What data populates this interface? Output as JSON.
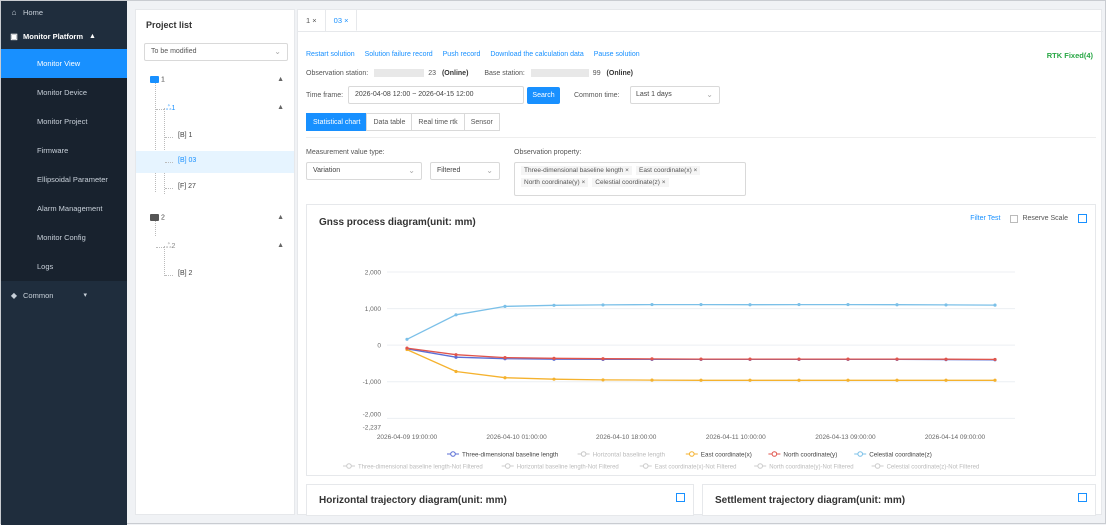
{
  "sidebar": {
    "home": "Home",
    "platform": "Monitor Platform",
    "items": [
      "Monitor View",
      "Monitor Device",
      "Monitor Project",
      "Firmware",
      "Ellipsoidal Parameter",
      "Alarm Management",
      "Monitor Config",
      "Logs"
    ],
    "common": "Common"
  },
  "project": {
    "title": "Project list",
    "select_value": "To be modified",
    "nodes": [
      "1",
      "1",
      "[B] 1",
      "[B] 03",
      "[F] 27",
      "2",
      "2",
      "[B] 2"
    ]
  },
  "tabs": [
    {
      "label": "1"
    },
    {
      "label": "03"
    }
  ],
  "actions": [
    "Restart solution",
    "Solution failure record",
    "Push record",
    "Download the calculation data",
    "Pause solution"
  ],
  "rtk_status": "RTK Fixed(4)",
  "stations": {
    "obs_label": "Observation station:",
    "obs_suffix": "23",
    "obs_status": "(Online)",
    "base_label": "Base station:",
    "base_suffix": "99",
    "base_status": "(Online)"
  },
  "timeframe": {
    "label": "Time frame:",
    "value": "2026-04-08 12:00  ~  2026-04-15 12:00",
    "search": "Search",
    "common_label": "Common time:",
    "common_value": "Last 1 days"
  },
  "subtabs": [
    "Statistical chart",
    "Data table",
    "Real time rtk",
    "Sensor"
  ],
  "filters": {
    "mvt_label": "Measurement value type:",
    "mvt_value": "Variation",
    "filter_value": "Filtered",
    "op_label": "Observation property:",
    "op_tags": [
      "Three-dimensional baseline length",
      "East coordinate(x)",
      "North coordinate(y)",
      "Celestial coordinate(z)"
    ]
  },
  "chart_tools": {
    "filter_test": "Filter Test",
    "reserve_scale": "Reserve Scale"
  },
  "cards": {
    "horizontal": "Horizontal trajectory diagram(unit: mm)",
    "settlement": "Settlement trajectory diagram(unit: mm)"
  },
  "chart_data": {
    "type": "line",
    "title": "Gnss process diagram(unit: mm)",
    "ylim": [
      -2237,
      2000
    ],
    "yticks": [
      "2,000",
      "1,000",
      "0",
      "-1,000",
      "-2,000",
      "-2,237"
    ],
    "ytick_values": [
      2000,
      1000,
      0,
      -1000,
      -2000,
      -2237
    ],
    "xticks": [
      "2026-04-09 19:00:00",
      "2026-04-10 01:00:00",
      "2026-04-10 18:00:00",
      "2026-04-11 10:00:00",
      "2026-04-13 09:00:00",
      "2026-04-14 09:00:00"
    ],
    "grid": true,
    "legend_position": "bottom",
    "series": [
      {
        "name": "Three-dimensional baseline length",
        "color": "#5b6fd6",
        "active": true,
        "values": [
          -100,
          -330,
          -370,
          -385,
          -390,
          -390,
          -390,
          -390,
          -390,
          -390,
          -390,
          -395,
          -400
        ]
      },
      {
        "name": "Horizontal baseline length",
        "color": "#c8c8c8",
        "active": false,
        "values": []
      },
      {
        "name": "East coordinate(x)",
        "color": "#f5b22e",
        "active": true,
        "values": [
          -120,
          -720,
          -890,
          -930,
          -950,
          -955,
          -960,
          -960,
          -960,
          -960,
          -960,
          -960,
          -960
        ]
      },
      {
        "name": "North coordinate(y)",
        "color": "#e0554d",
        "active": true,
        "values": [
          -80,
          -260,
          -340,
          -360,
          -370,
          -375,
          -380,
          -380,
          -380,
          -380,
          -380,
          -385,
          -390
        ]
      },
      {
        "name": "Celestial coordinate(z)",
        "color": "#7bc0e8",
        "active": true,
        "values": [
          160,
          830,
          1060,
          1090,
          1100,
          1110,
          1110,
          1105,
          1110,
          1110,
          1105,
          1100,
          1095
        ]
      }
    ],
    "legend_row2": [
      "Three-dimensional baseline length-Not Filtered",
      "Horizontal baseline length-Not Filtered",
      "East coordinate(x)-Not Filtered",
      "North coordinate(y)-Not Filtered",
      "Celestial coordinate(z)-Not Filtered"
    ]
  }
}
